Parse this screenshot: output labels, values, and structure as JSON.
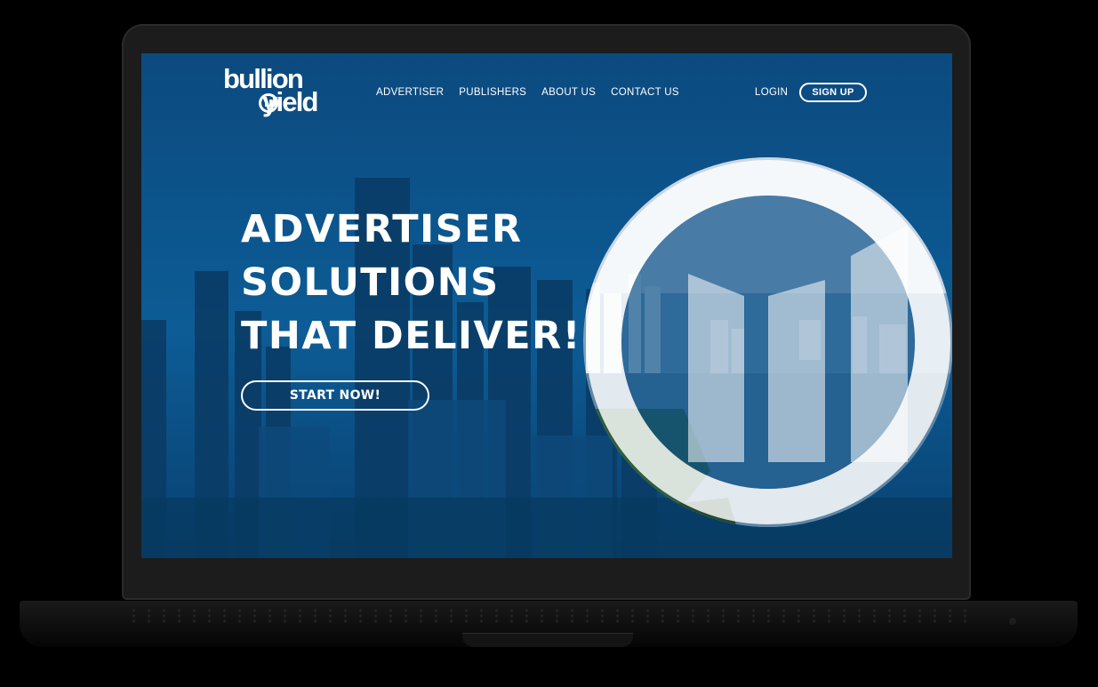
{
  "header": {
    "logo": {
      "line1": "bullion",
      "line2": "yield"
    },
    "nav": [
      {
        "label": "ADVERTISER"
      },
      {
        "label": "PUBLISHERS"
      },
      {
        "label": "ABOUT US"
      },
      {
        "label": "CONTACT US"
      }
    ],
    "login_label": "LOGIN",
    "signup_label": "SIGN UP"
  },
  "hero": {
    "headline_lines": [
      "ADVERTISER",
      "SOLUTIONS",
      "THAT DELIVER!"
    ],
    "cta_label": "START NOW!"
  },
  "colors": {
    "brand_blue": "#0a4f86",
    "text": "#ffffff"
  }
}
